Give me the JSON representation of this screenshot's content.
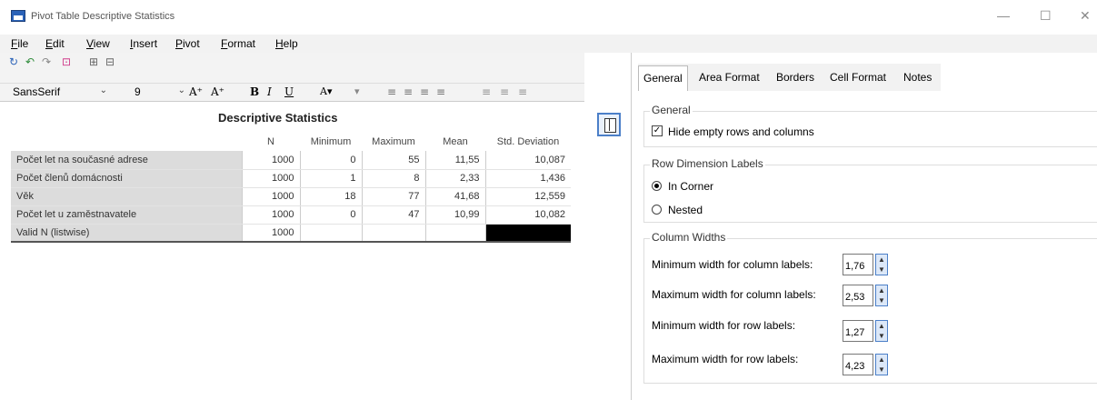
{
  "window": {
    "title": "Pivot Table Descriptive Statistics",
    "minimize": "—",
    "maximize": "☐",
    "close": "✕"
  },
  "menu": [
    "File",
    "Edit",
    "View",
    "Insert",
    "Pivot",
    "Format",
    "Help"
  ],
  "toolbar": {
    "font": "SansSerif",
    "size": "9",
    "grow": "A⁺",
    "shrink": "A⁺",
    "bold": "B",
    "italic": "I",
    "underline": "U"
  },
  "table": {
    "title": "Descriptive Statistics",
    "headers": [
      "",
      "N",
      "Minimum",
      "Maximum",
      "Mean",
      "Std. Deviation"
    ],
    "rows": [
      [
        "Počet let na současné adrese",
        "1000",
        "0",
        "55",
        "11,55",
        "10,087"
      ],
      [
        "Počet členů domácnosti",
        "1000",
        "1",
        "8",
        "2,33",
        "1,436"
      ],
      [
        "Věk",
        "1000",
        "18",
        "77",
        "41,68",
        "12,559"
      ],
      [
        "Počet let u zaměstnavatele",
        "1000",
        "0",
        "47",
        "10,99",
        "10,082"
      ],
      [
        "Valid N (listwise)",
        "1000",
        "",
        "",
        "",
        ""
      ]
    ]
  },
  "panel": {
    "tabs": [
      "General",
      "Area Format",
      "Borders",
      "Cell Format",
      "Notes"
    ],
    "general_group": "General",
    "hide_empty": "Hide empty rows and columns",
    "row_dim_group": "Row Dimension Labels",
    "in_corner": "In Corner",
    "nested": "Nested",
    "col_widths_group": "Column Widths",
    "fields": [
      {
        "label": "Minimum width for column labels:",
        "value": "1,76"
      },
      {
        "label": "Maximum width for column labels:",
        "value": "2,53"
      },
      {
        "label": "Minimum width for row labels:",
        "value": "1,27"
      },
      {
        "label": "Maximum width for row labels:",
        "value": "4,23"
      }
    ]
  }
}
